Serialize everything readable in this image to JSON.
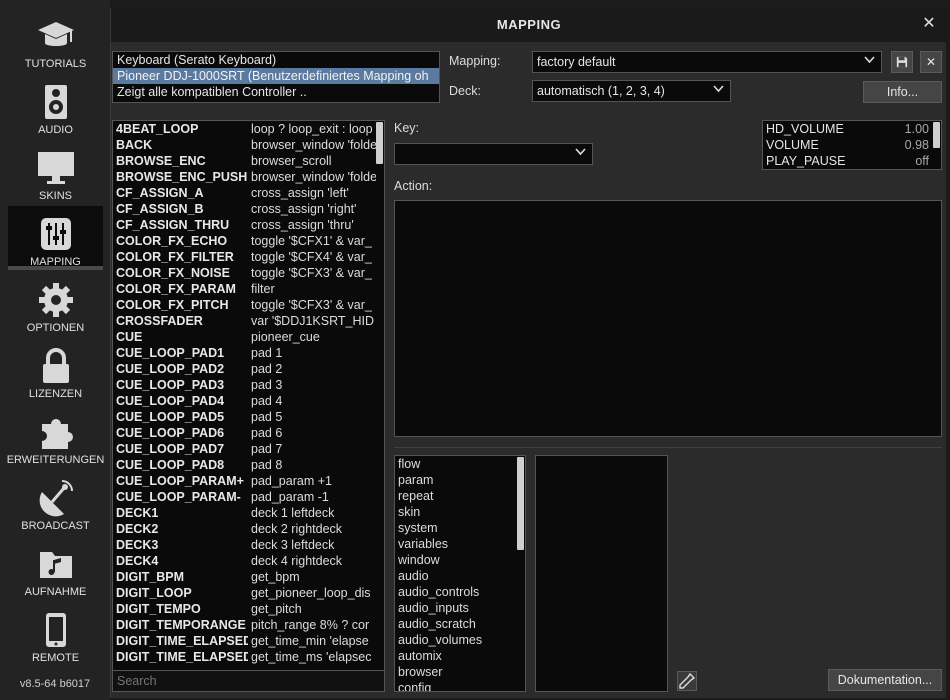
{
  "sidebar": {
    "items": [
      {
        "label": "TUTORIALS",
        "icon": "graduation-cap-icon"
      },
      {
        "label": "AUDIO",
        "icon": "speaker-icon"
      },
      {
        "label": "SKINS",
        "icon": "monitor-icon"
      },
      {
        "label": "MAPPING",
        "icon": "sliders-icon"
      },
      {
        "label": "OPTIONEN",
        "icon": "gear-icon"
      },
      {
        "label": "LIZENZEN",
        "icon": "lock-icon"
      },
      {
        "label": "ERWEITERUNGEN",
        "icon": "puzzle-icon"
      },
      {
        "label": "BROADCAST",
        "icon": "satellite-dish-icon"
      },
      {
        "label": "AUFNAHME",
        "icon": "music-folder-icon"
      },
      {
        "label": "REMOTE",
        "icon": "phone-icon"
      }
    ],
    "active": "MAPPING",
    "version": "v8.5-64 b6017"
  },
  "dialog": {
    "title": "MAPPING",
    "close": "✕"
  },
  "controllers": [
    "Keyboard (Serato Keyboard)",
    "Pioneer DDJ-1000SRT (Benutzerdefiniertes Mapping oh",
    "Zeigt alle kompatiblen Controller .."
  ],
  "mapping": {
    "label": "Mapping:",
    "value": "factory default",
    "save_icon": "save-icon",
    "delete_label": "✕"
  },
  "deck": {
    "label": "Deck:",
    "value": "automatisch (1, 2, 3, 4)"
  },
  "info_button": "Info...",
  "key": {
    "label": "Key:",
    "value": ""
  },
  "action": {
    "label": "Action:"
  },
  "keys": [
    [
      "4BEAT_LOOP",
      "loop ? loop_exit : loop"
    ],
    [
      "BACK",
      "browser_window 'folde"
    ],
    [
      "BROWSE_ENC",
      "browser_scroll"
    ],
    [
      "BROWSE_ENC_PUSH",
      "browser_window 'folde"
    ],
    [
      "CF_ASSIGN_A",
      "cross_assign 'left'"
    ],
    [
      "CF_ASSIGN_B",
      "cross_assign 'right'"
    ],
    [
      "CF_ASSIGN_THRU",
      "cross_assign 'thru'"
    ],
    [
      "COLOR_FX_ECHO",
      "toggle '$CFX1' & var_"
    ],
    [
      "COLOR_FX_FILTER",
      "toggle '$CFX4' & var_"
    ],
    [
      "COLOR_FX_NOISE",
      "toggle '$CFX3' & var_"
    ],
    [
      "COLOR_FX_PARAM",
      "filter"
    ],
    [
      "COLOR_FX_PITCH",
      "toggle '$CFX3' & var_"
    ],
    [
      "CROSSFADER",
      "var '$DDJ1KSRT_HID"
    ],
    [
      "CUE",
      "pioneer_cue"
    ],
    [
      "CUE_LOOP_PAD1",
      "pad 1"
    ],
    [
      "CUE_LOOP_PAD2",
      "pad 2"
    ],
    [
      "CUE_LOOP_PAD3",
      "pad 3"
    ],
    [
      "CUE_LOOP_PAD4",
      "pad 4"
    ],
    [
      "CUE_LOOP_PAD5",
      "pad 5"
    ],
    [
      "CUE_LOOP_PAD6",
      "pad 6"
    ],
    [
      "CUE_LOOP_PAD7",
      "pad 7"
    ],
    [
      "CUE_LOOP_PAD8",
      "pad 8"
    ],
    [
      "CUE_LOOP_PARAM+",
      "pad_param +1"
    ],
    [
      "CUE_LOOP_PARAM-",
      "pad_param -1"
    ],
    [
      "DECK1",
      "deck 1 leftdeck"
    ],
    [
      "DECK2",
      "deck 2 rightdeck"
    ],
    [
      "DECK3",
      "deck 3 leftdeck"
    ],
    [
      "DECK4",
      "deck 4 rightdeck"
    ],
    [
      "DIGIT_BPM",
      "get_bpm"
    ],
    [
      "DIGIT_LOOP",
      "get_pioneer_loop_dis"
    ],
    [
      "DIGIT_TEMPO",
      "get_pitch"
    ],
    [
      "DIGIT_TEMPORANGE",
      "pitch_range 8% ? cor"
    ],
    [
      "DIGIT_TIME_ELAPSED",
      "get_time_min 'elapse"
    ],
    [
      "DIGIT_TIME_ELAPSED",
      "get_time_ms 'elapsec"
    ]
  ],
  "search": {
    "placeholder": "Search"
  },
  "variables": [
    {
      "name": "HD_VOLUME",
      "value": "1.00"
    },
    {
      "name": "VOLUME",
      "value": "0.98"
    },
    {
      "name": "PLAY_PAUSE",
      "value": "off"
    }
  ],
  "categories": [
    "flow",
    "param",
    "repeat",
    "skin",
    "system",
    "variables",
    "window",
    "audio",
    "audio_controls",
    "audio_inputs",
    "audio_scratch",
    "audio_volumes",
    "automix",
    "browser",
    "config"
  ],
  "doc_button": "Dokumentation..."
}
